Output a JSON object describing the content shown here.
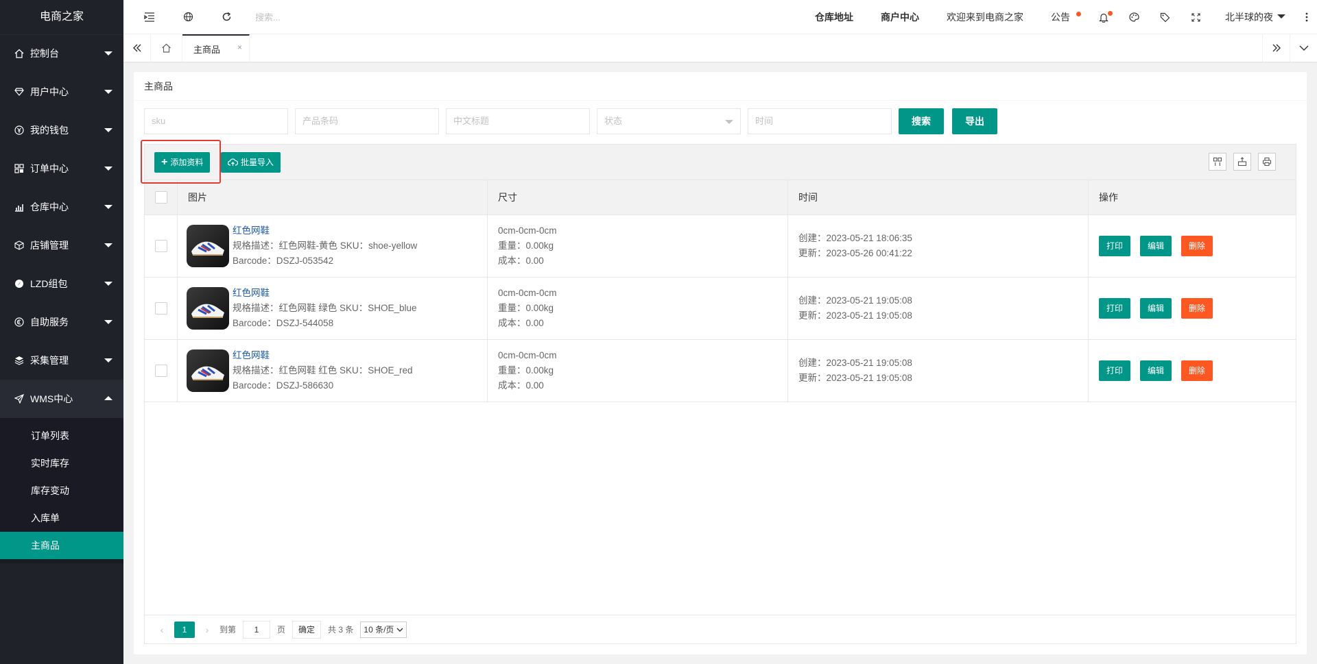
{
  "sidebar": {
    "logo": "电商之家",
    "items": [
      {
        "label": "控制台",
        "icon": "home-icon"
      },
      {
        "label": "用户中心",
        "icon": "diamond-icon"
      },
      {
        "label": "我的钱包",
        "icon": "yen-icon"
      },
      {
        "label": "订单中心",
        "icon": "grid-icon"
      },
      {
        "label": "仓库中心",
        "icon": "chart-icon"
      },
      {
        "label": "店铺管理",
        "icon": "box-icon"
      },
      {
        "label": "LZD组包",
        "icon": "compass-icon"
      },
      {
        "label": "自助服务",
        "icon": "euro-icon"
      },
      {
        "label": "采集管理",
        "icon": "layers-icon"
      },
      {
        "label": "WMS中心",
        "icon": "send-icon"
      }
    ],
    "submenu": [
      "订单列表",
      "实时库存",
      "库存变动",
      "入库单",
      "主商品"
    ]
  },
  "header": {
    "search_placeholder": "搜索...",
    "links": {
      "warehouse": "仓库地址",
      "merchant": "商户中心",
      "welcome": "欢迎来到电商之家",
      "notice": "公告"
    },
    "username": "北半球的夜"
  },
  "tabs": {
    "active": "主商品",
    "close": "×"
  },
  "main": {
    "title": "主商品",
    "filters": {
      "sku": "sku",
      "barcode": "产品条码",
      "cn_title": "中文标题",
      "status": "状态",
      "time": "时间"
    },
    "search_label": "搜索",
    "export_label": "导出",
    "toolbar": {
      "add_label": "添加资料",
      "import_label": "批量导入"
    },
    "columns": {
      "image": "图片",
      "size": "尺寸",
      "time": "时间",
      "ops": "操作"
    },
    "rows": [
      {
        "name": "红色网鞋",
        "spec": "规格描述：红色网鞋-黄色   SKU：shoe-yellow",
        "barcode": "Barcode：DSZJ-053542",
        "dims": "0cm-0cm-0cm",
        "weight": "重量：0.00kg",
        "cost": "成本：0.00",
        "created": "创建：2023-05-21 18:06:35",
        "updated": "更新：2023-05-26 00:41:22"
      },
      {
        "name": "红色网鞋",
        "spec": "规格描述：红色网鞋 绿色   SKU：SHOE_blue",
        "barcode": "Barcode：DSZJ-544058",
        "dims": "0cm-0cm-0cm",
        "weight": "重量：0.00kg",
        "cost": "成本：0.00",
        "created": "创建：2023-05-21 19:05:08",
        "updated": "更新：2023-05-21 19:05:08"
      },
      {
        "name": "红色网鞋",
        "spec": "规格描述：红色网鞋 红色   SKU：SHOE_red",
        "barcode": "Barcode：DSZJ-586630",
        "dims": "0cm-0cm-0cm",
        "weight": "重量：0.00kg",
        "cost": "成本：0.00",
        "created": "创建：2023-05-21 19:05:08",
        "updated": "更新：2023-05-21 19:05:08"
      }
    ],
    "ops": {
      "print": "打印",
      "edit": "编辑",
      "delete": "删除"
    },
    "pager": {
      "current": "1",
      "goto": "到第",
      "page_input": "1",
      "page_unit": "页",
      "confirm": "确定",
      "total": "共 3 条",
      "per_page": "10 条/页"
    }
  },
  "colors": {
    "accent": "#009688",
    "danger": "#ff5722",
    "sidebar_bg": "#20222a"
  }
}
